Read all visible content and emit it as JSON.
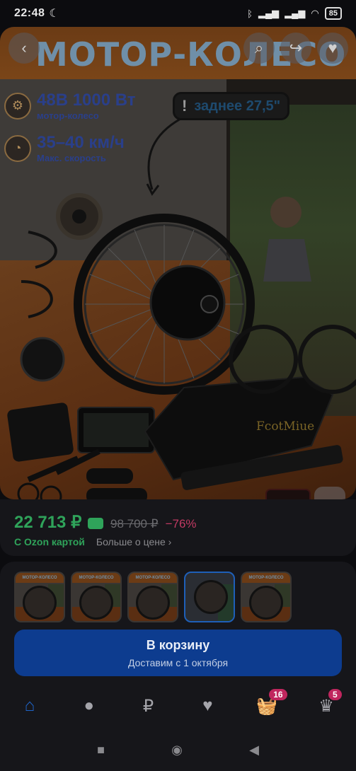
{
  "status_bar": {
    "time": "22:48",
    "battery": "85"
  },
  "hero": {
    "title": "МОТОР-КОЛЕСО",
    "feature1_big": "48В 1000 Вт",
    "feature1_small": "мотор-колесо",
    "feature2_big": "35–40 км/ч",
    "feature2_small": "Макс. скорость",
    "callout_mark": "!",
    "callout_text": "заднее 27,5\"",
    "brand": "FcotMiue"
  },
  "price": {
    "current": "22 713 ₽",
    "old": "98 700 ₽",
    "discount": "−76%",
    "ozon_card": "С Ozon картой",
    "more": "Больше о цене"
  },
  "cart": {
    "label": "В корзину",
    "delivery": "Доставим с 1 октября"
  },
  "nav": {
    "cart_badge": "16",
    "profile_badge": "5"
  },
  "thumb_title": "МОТОР-КОЛЕСО"
}
